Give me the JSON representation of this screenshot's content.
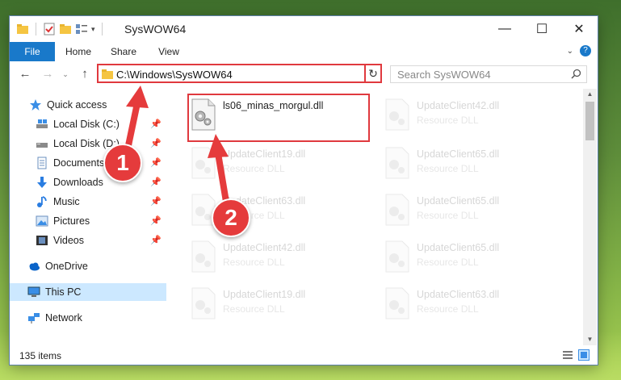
{
  "window": {
    "title": "SysWOW64",
    "controls": [
      "minimize-icon",
      "maximize-icon",
      "close-icon"
    ]
  },
  "ribbon": {
    "tabs": [
      "File",
      "Home",
      "Share",
      "View"
    ]
  },
  "address": {
    "path": "C:\\Windows\\SysWOW64",
    "search_placeholder": "Search SysWOW64"
  },
  "sidebar": {
    "items": [
      {
        "label": "Quick access",
        "icon": "star-icon",
        "pinned": false
      },
      {
        "label": "Local Disk (C:)",
        "icon": "drive-icon",
        "pinned": true
      },
      {
        "label": "Local Disk (D:)",
        "icon": "drive-icon",
        "pinned": true
      },
      {
        "label": "Documents",
        "icon": "documents-icon",
        "pinned": true
      },
      {
        "label": "Downloads",
        "icon": "downloads-icon",
        "pinned": true
      },
      {
        "label": "Music",
        "icon": "music-icon",
        "pinned": true
      },
      {
        "label": "Pictures",
        "icon": "pictures-icon",
        "pinned": true
      },
      {
        "label": "Videos",
        "icon": "videos-icon",
        "pinned": true
      },
      {
        "label": "OneDrive",
        "icon": "cloud-icon",
        "pinned": false
      },
      {
        "label": "This PC",
        "icon": "computer-icon",
        "pinned": false,
        "selected": true
      },
      {
        "label": "Network",
        "icon": "network-icon",
        "pinned": false
      }
    ]
  },
  "files": {
    "highlighted": {
      "name": "ls06_minas_morgul.dll",
      "type": ""
    },
    "faded": [
      {
        "name": "UpdateClient42.dll",
        "type": "Resource DLL"
      },
      {
        "name": "UpdateClient19.dll",
        "type": "Resource DLL"
      },
      {
        "name": "UpdateClient65.dll",
        "type": "Resource DLL"
      },
      {
        "name": "UpdateClient63.dll",
        "type": "Resource DLL"
      },
      {
        "name": "UpdateClient65.dll",
        "type": "Resource DLL"
      },
      {
        "name": "UpdateClient42.dll",
        "type": "Resource DLL"
      },
      {
        "name": "UpdateClient65.dll",
        "type": "Resource DLL"
      },
      {
        "name": "UpdateClient19.dll",
        "type": "Resource DLL"
      },
      {
        "name": "UpdateClient63.dll",
        "type": "Resource DLL"
      }
    ]
  },
  "status": {
    "count": "135 items"
  },
  "callouts": [
    "1",
    "2"
  ],
  "colors": {
    "accent": "#1979ca",
    "callout": "#e53b3c",
    "selection": "#cce8ff"
  }
}
